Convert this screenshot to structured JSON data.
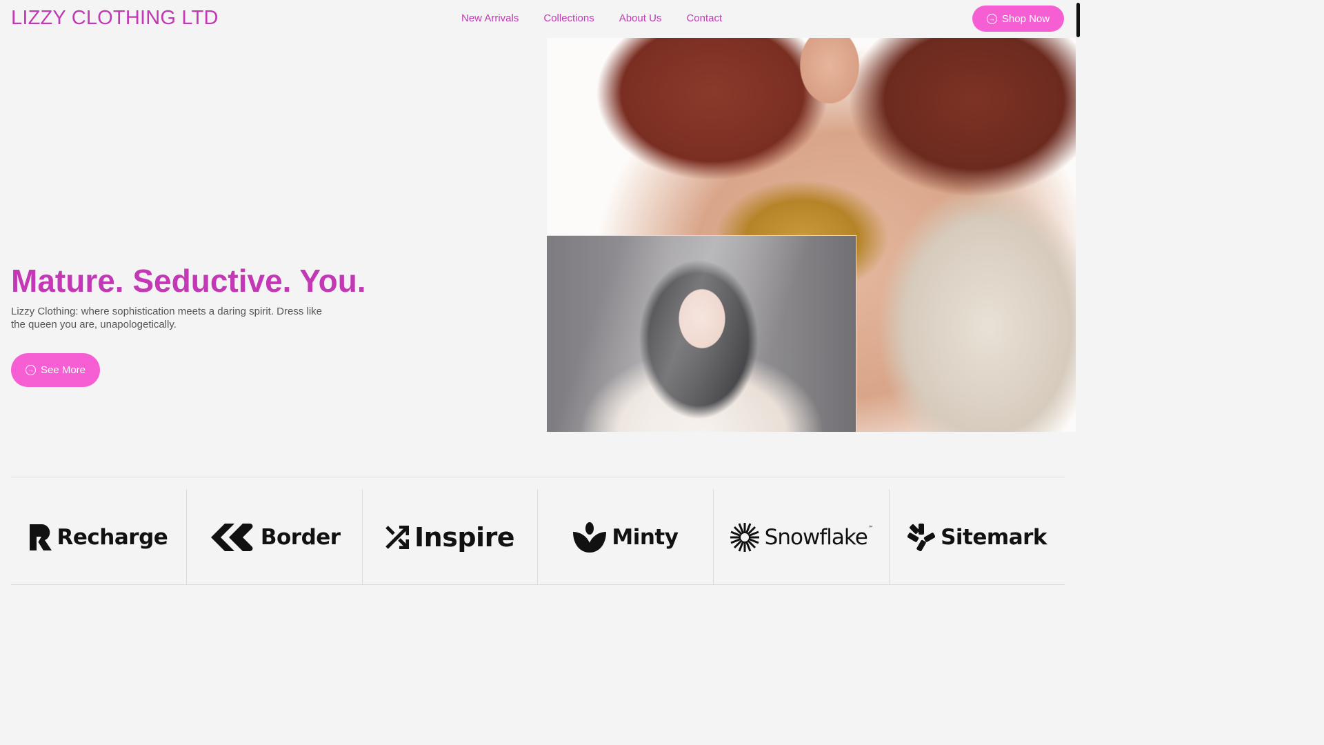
{
  "header": {
    "brand": "LIZZY CLOTHING LTD",
    "nav": [
      "New Arrivals",
      "Collections",
      "About Us",
      "Contact"
    ],
    "shop_button": "Shop Now"
  },
  "hero": {
    "title": "Mature. Seductive. You.",
    "text": "Lizzy Clothing: where sophistication meets a daring spirit. Dress like the queen you are, unapologetically.",
    "button": "See More"
  },
  "logos": [
    {
      "name": "Recharge",
      "icon": "recharge-logo-icon"
    },
    {
      "name": "Border",
      "icon": "border-logo-icon"
    },
    {
      "name": "Inspire",
      "icon": "inspire-logo-icon"
    },
    {
      "name": "Minty",
      "icon": "minty-logo-icon"
    },
    {
      "name": "Snowflake",
      "icon": "snowflake-logo-icon"
    },
    {
      "name": "Sitemark",
      "icon": "sitemark-logo-icon"
    }
  ],
  "colors": {
    "accent": "#c238b5",
    "button": "#f65fd3",
    "background": "#f4f4f4"
  }
}
